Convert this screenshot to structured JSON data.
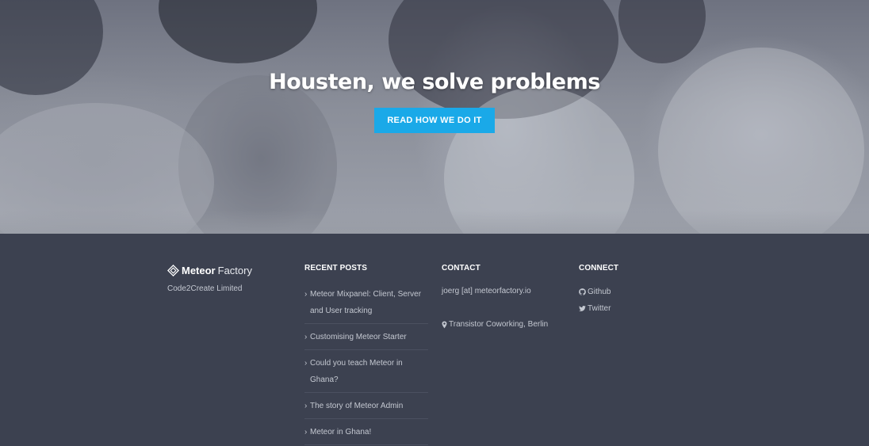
{
  "hero": {
    "title": "Housten, we solve problems",
    "button_label": "READ HOW WE DO IT",
    "button_color": "#1aa9e8"
  },
  "footer": {
    "brand": {
      "logo_icon": "meteor-diamond-logo",
      "name_bold": "Meteor",
      "name_light": "Factory",
      "subtitle": "Code2Create Limited"
    },
    "recent_posts": {
      "title": "RECENT POSTS",
      "items": [
        "Meteor Mixpanel: Client, Server and User tracking",
        "Customising Meteor Starter",
        "Could you teach Meteor in Ghana?",
        "The story of Meteor Admin",
        "Meteor in Ghana!"
      ]
    },
    "contact": {
      "title": "CONTACT",
      "email": "joerg [at] meteorfactory.io",
      "location": "Transistor Coworking, Berlin",
      "location_icon": "map-marker-icon"
    },
    "connect": {
      "title": "CONNECT",
      "links": [
        {
          "label": "Github",
          "icon": "github-icon"
        },
        {
          "label": "Twitter",
          "icon": "twitter-icon"
        }
      ]
    },
    "background_color": "#3c4150"
  }
}
